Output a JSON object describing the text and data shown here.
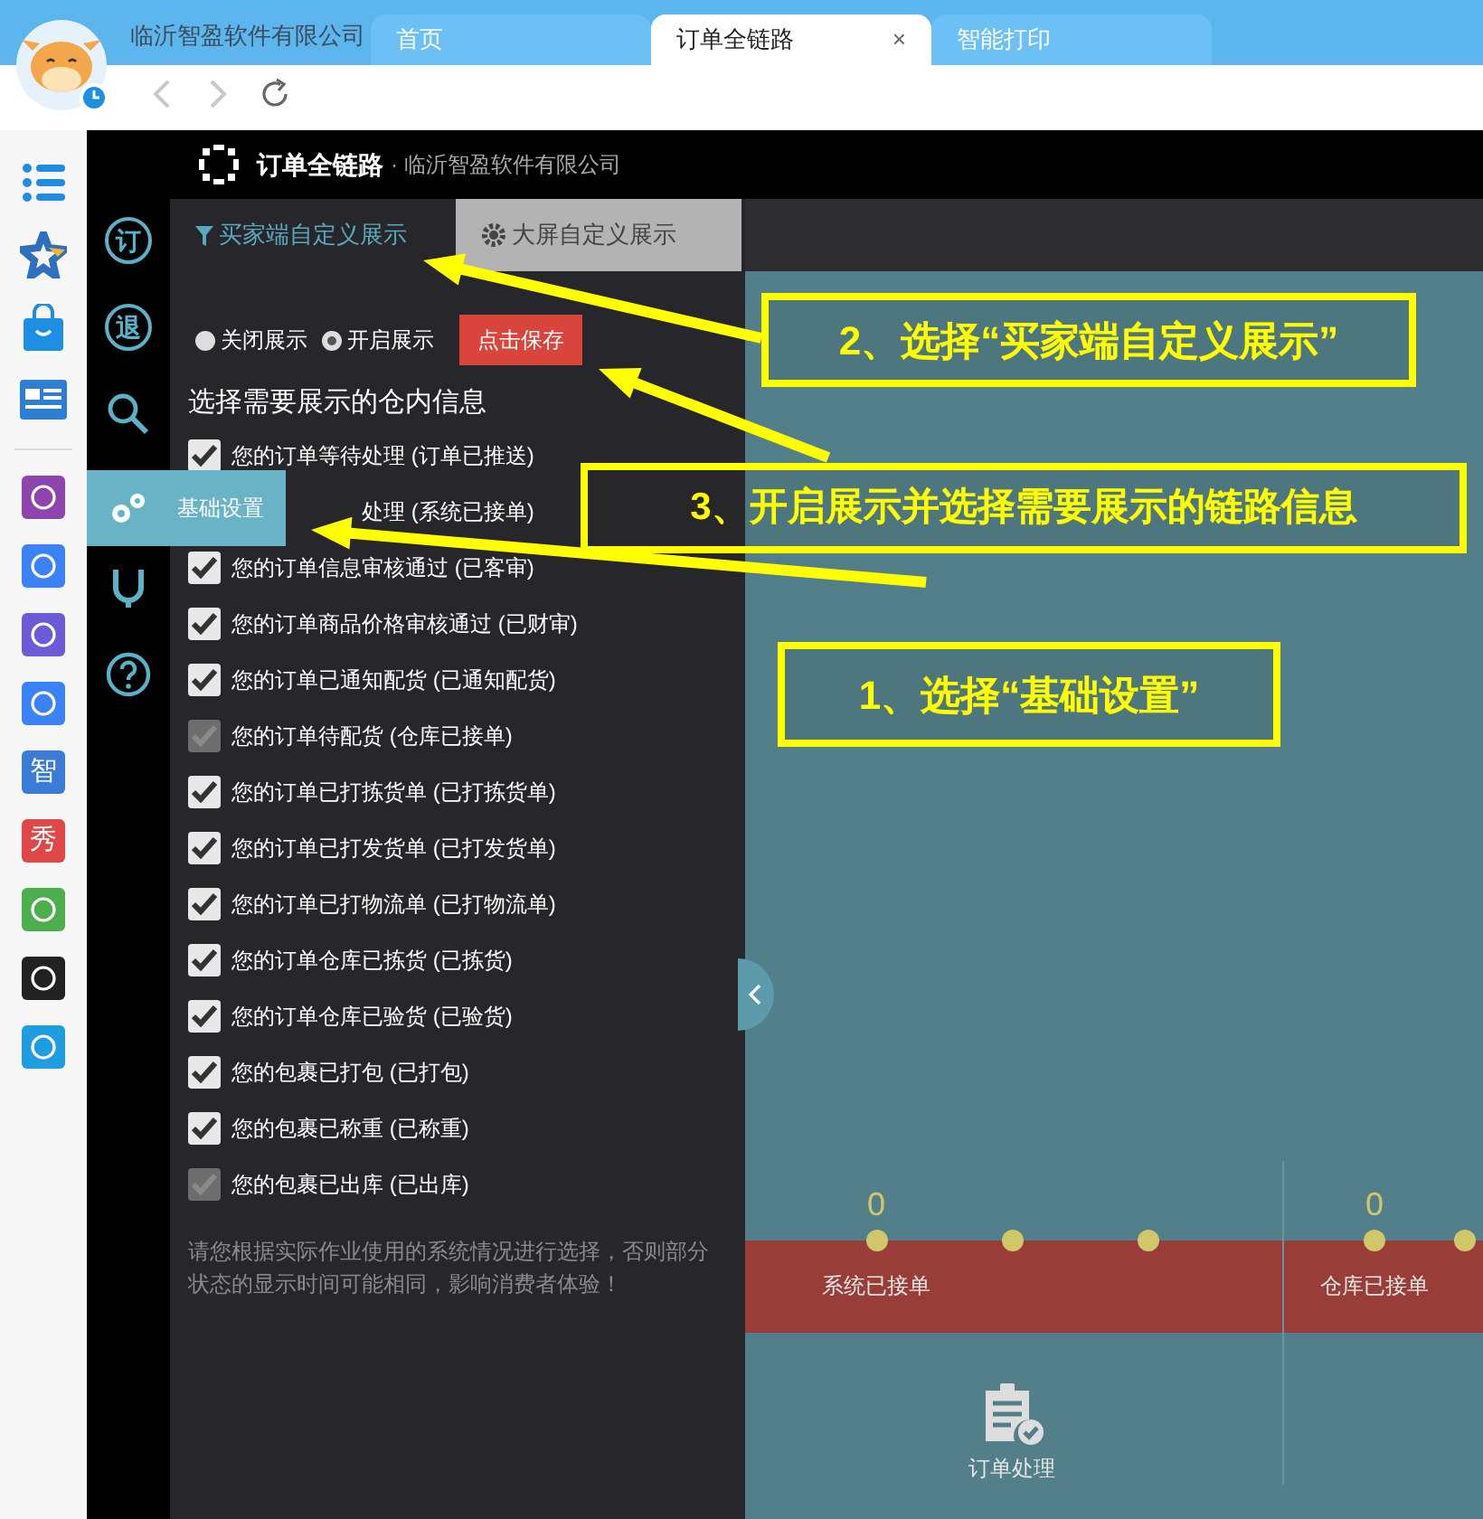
{
  "browser": {
    "profile_name": "临沂智盈软件有限公司",
    "tabs": [
      {
        "label": "首页",
        "selected": false
      },
      {
        "label": "订单全链路",
        "selected": true,
        "close": "×"
      },
      {
        "label": "智能打印",
        "selected": false
      }
    ]
  },
  "dock": [
    {
      "kind": "list"
    },
    {
      "kind": "star"
    },
    {
      "kind": "bag"
    },
    {
      "kind": "card"
    },
    {
      "kind": "divider"
    },
    {
      "kind": "app",
      "color": "#8e44ad"
    },
    {
      "kind": "app",
      "color": "#3b82f6"
    },
    {
      "kind": "app",
      "color": "#6b5bd6"
    },
    {
      "kind": "app",
      "color": "#3b82f6"
    },
    {
      "kind": "glyph",
      "color": "#3a7bd5",
      "glyph": "智"
    },
    {
      "kind": "glyph",
      "color": "#e04848",
      "glyph": "秀"
    },
    {
      "kind": "app",
      "color": "#4cae4c"
    },
    {
      "kind": "app",
      "color": "#222222"
    },
    {
      "kind": "app",
      "color": "#1e9ee0"
    }
  ],
  "header": {
    "title": "订单全链路",
    "subtitle": "· 临沂智盈软件有限公司"
  },
  "rail": [
    {
      "kind": "glyph",
      "glyph": "订"
    },
    {
      "kind": "glyph",
      "glyph": "退"
    },
    {
      "kind": "search"
    },
    {
      "kind": "settings",
      "selected": true,
      "label": "基础设置"
    },
    {
      "kind": "stethoscope"
    },
    {
      "kind": "help"
    }
  ],
  "panel": {
    "tabs": [
      {
        "label": "买家端自定义展示",
        "selected": true
      },
      {
        "label": "大屏自定义展示",
        "selected": false
      }
    ],
    "radios": [
      {
        "label": "关闭展示",
        "selected": false
      },
      {
        "label": "开启展示",
        "selected": true
      }
    ],
    "save_button": "点击保存",
    "heading": "选择需要展示的仓内信息",
    "items": [
      {
        "label": "您的订单等待处理 (订单已推送)",
        "checked": true,
        "disabled": false
      },
      {
        "label": "处理 (系统已接单)"
      },
      {
        "label": "您的订单信息审核通过 (已客审)",
        "checked": true,
        "disabled": false
      },
      {
        "label": "您的订单商品价格审核通过 (已财审)",
        "checked": true,
        "disabled": false
      },
      {
        "label": "您的订单已通知配货 (已通知配货)",
        "checked": true,
        "disabled": false
      },
      {
        "label": "您的订单待配货 (仓库已接单)",
        "checked": true,
        "disabled": true
      },
      {
        "label": "您的订单已打拣货单 (已打拣货单)",
        "checked": true,
        "disabled": false
      },
      {
        "label": "您的订单已打发货单 (已打发货单)",
        "checked": true,
        "disabled": false
      },
      {
        "label": "您的订单已打物流单 (已打物流单)",
        "checked": true,
        "disabled": false
      },
      {
        "label": "您的订单仓库已拣货 (已拣货)",
        "checked": true,
        "disabled": false
      },
      {
        "label": "您的订单仓库已验货 (已验货)",
        "checked": true,
        "disabled": false
      },
      {
        "label": "您的包裹已打包 (已打包)",
        "checked": true,
        "disabled": false
      },
      {
        "label": "您的包裹已称重 (已称重)",
        "checked": true,
        "disabled": false
      },
      {
        "label": "您的包裹已出库 (已出库)",
        "checked": true,
        "disabled": true
      }
    ],
    "note": "请您根据实际作业使用的系统情况进行选择，否则部分状态的显示时间可能相同，影响消费者体验！"
  },
  "timeline": {
    "sections": [
      {
        "stages": [
          {
            "kind": "stage",
            "count": "0",
            "label": "系统已接单"
          },
          {
            "kind": "stage",
            "process": "订单处理"
          },
          {
            "kind": "stage"
          }
        ]
      },
      {
        "stages": [
          {
            "kind": "stage",
            "count": "0",
            "label": "仓库已接单"
          },
          {
            "kind": "stage"
          }
        ]
      }
    ]
  },
  "annotations": [
    {
      "text": "2、选择“买家端自定义展示”"
    },
    {
      "text": "3、开启展示并选择需要展示的链路信息"
    },
    {
      "text": "1、选择“基础设置”"
    }
  ]
}
